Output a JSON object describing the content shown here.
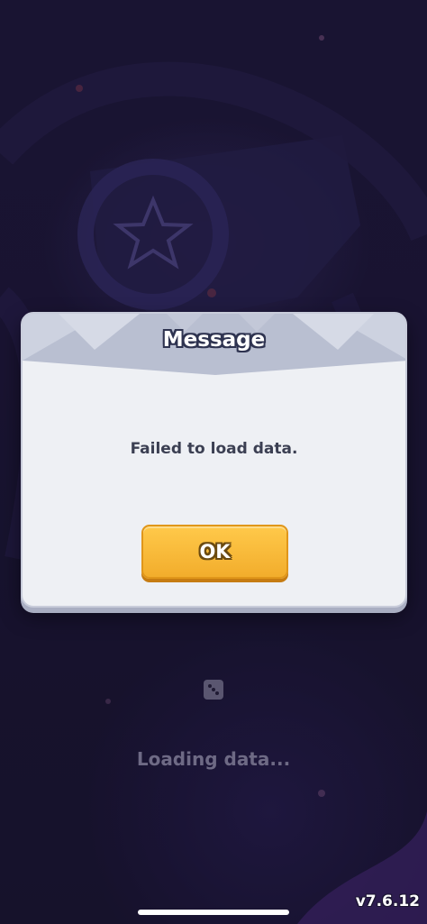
{
  "dialog": {
    "title": "Message",
    "message": "Failed to load data.",
    "ok_label": "OK"
  },
  "loading": {
    "text": "Loading data..."
  },
  "version": "v7.6.12",
  "colors": {
    "background": "#221a3e",
    "dialog_body": "#eef0f4",
    "dialog_header": "#b9bfd1",
    "button": "#f2ad2c",
    "text_dark": "#3b3f52"
  },
  "icons": {
    "loading": "dice-icon",
    "background_emblem": "star-icon"
  }
}
